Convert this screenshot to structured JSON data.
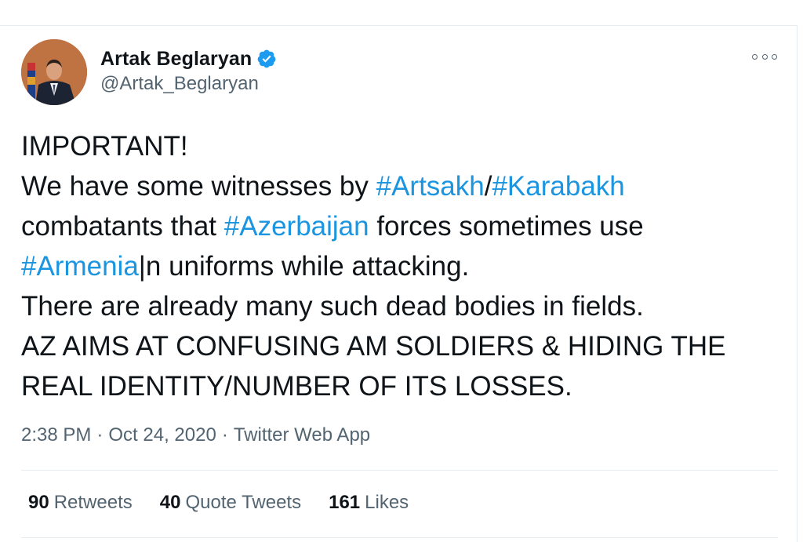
{
  "author": {
    "display_name": "Artak Beglaryan",
    "handle": "@Artak_Beglaryan",
    "verified": true
  },
  "tweet": {
    "lines": [
      [
        {
          "text": "IMPORTANT!",
          "type": "text"
        }
      ],
      [
        {
          "text": "We have some witnesses by ",
          "type": "text"
        },
        {
          "text": "#Artsakh",
          "type": "hashtag"
        },
        {
          "text": "/",
          "type": "text"
        },
        {
          "text": "#Karabakh",
          "type": "hashtag"
        }
      ],
      [
        {
          "text": "combatants that ",
          "type": "text"
        },
        {
          "text": "#Azerbaijan",
          "type": "hashtag"
        },
        {
          "text": " forces sometimes use",
          "type": "text"
        }
      ],
      [
        {
          "text": "#Armenia",
          "type": "hashtag"
        },
        {
          "text": "|n uniforms while attacking.",
          "type": "text"
        }
      ],
      [
        {
          "text": "There are already many such dead bodies in fields.",
          "type": "text"
        }
      ],
      [
        {
          "text": "AZ AIMS AT CONFUSING AM SOLDIERS & HIDING THE",
          "type": "text"
        }
      ],
      [
        {
          "text": "REAL IDENTITY/NUMBER OF ITS LOSSES.",
          "type": "text"
        }
      ]
    ]
  },
  "meta": {
    "time": "2:38 PM",
    "separator": "·",
    "date": "Oct 24, 2020",
    "source": "Twitter Web App"
  },
  "stats": {
    "retweets": {
      "count": "90",
      "label": "Retweets"
    },
    "quote_tweets": {
      "count": "40",
      "label": "Quote Tweets"
    },
    "likes": {
      "count": "161",
      "label": "Likes"
    }
  },
  "icons": {
    "verified": "verified-badge-icon",
    "more": "more-options-icon"
  },
  "colors": {
    "hashtag": "#1b95e0",
    "verified": "#1d9bf0",
    "secondary_text": "#536471",
    "primary_text": "#0f1419"
  }
}
